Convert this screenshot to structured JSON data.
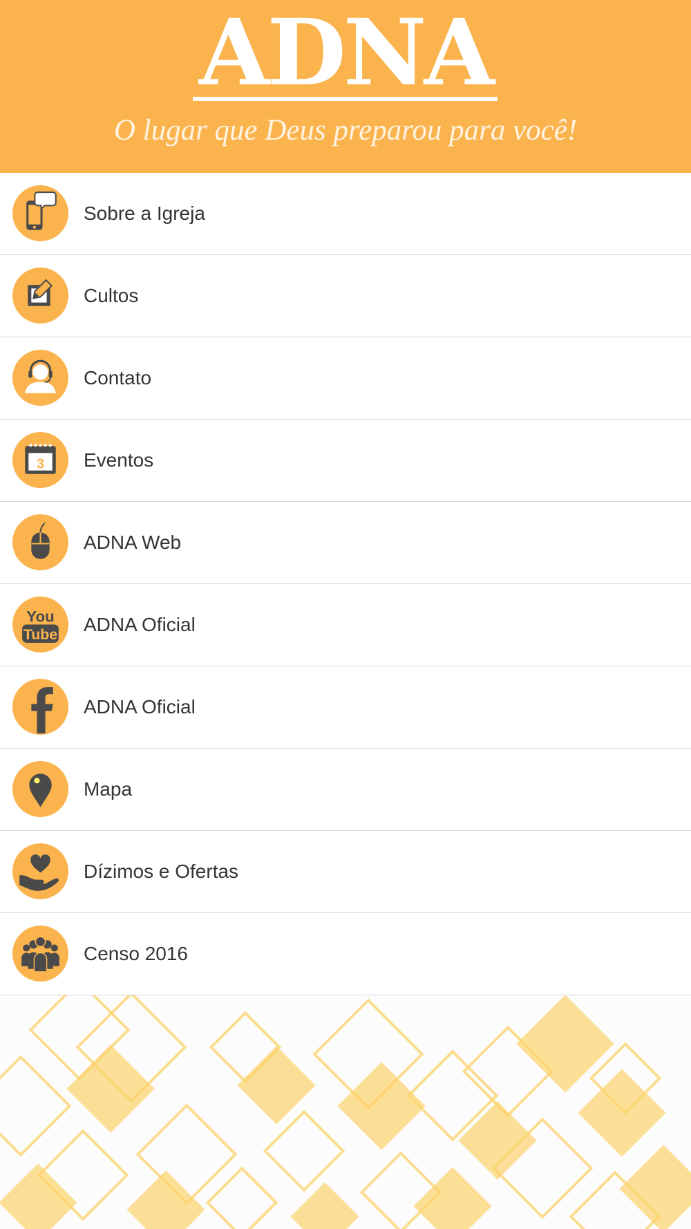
{
  "header": {
    "logo_text": "ADNA",
    "tagline": "O lugar que Deus preparou para você!"
  },
  "colors": {
    "brand_orange": "#fbb34e",
    "icon_glyph": "#4a4a4a",
    "label_text": "#333333",
    "divider": "#d9d9d9",
    "pattern_yellow": "#fcd36b"
  },
  "menu": {
    "items": [
      {
        "label": "Sobre a Igreja",
        "icon": "smartphone-chat-icon"
      },
      {
        "label": "Cultos",
        "icon": "edit-note-icon"
      },
      {
        "label": "Contato",
        "icon": "headset-person-icon"
      },
      {
        "label": "Eventos",
        "icon": "calendar-icon",
        "icon_text": "3"
      },
      {
        "label": "ADNA Web",
        "icon": "mouse-icon"
      },
      {
        "label": "ADNA Oficial",
        "icon": "youtube-icon",
        "icon_text_top": "You",
        "icon_text_bottom": "Tube"
      },
      {
        "label": "ADNA Oficial",
        "icon": "facebook-icon"
      },
      {
        "label": "Mapa",
        "icon": "map-pin-icon"
      },
      {
        "label": "Dízimos e Ofertas",
        "icon": "heart-hand-icon"
      },
      {
        "label": "Censo 2016",
        "icon": "people-group-icon"
      }
    ]
  }
}
